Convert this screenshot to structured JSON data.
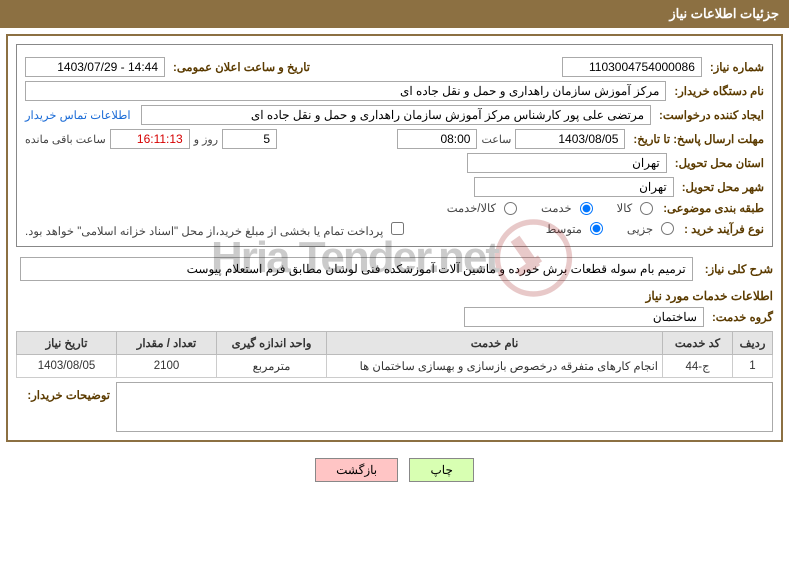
{
  "header": {
    "title": "جزئیات اطلاعات نیاز"
  },
  "need_number": {
    "label": "شماره نیاز:",
    "value": "1103004754000086"
  },
  "announce": {
    "label": "تاریخ و ساعت اعلان عمومی:",
    "value": "14:44 - 1403/07/29"
  },
  "buyer_org": {
    "label": "نام دستگاه خریدار:",
    "value": "مرکز آموزش سازمان راهداری و حمل و نقل جاده ای"
  },
  "requester": {
    "label": "ایجاد کننده درخواست:",
    "value": "مرتضی علی پور کارشناس مرکز آموزش سازمان راهداری و حمل و نقل جاده ای"
  },
  "buyer_contact_link": "اطلاعات تماس خریدار",
  "deadline": {
    "label": "مهلت ارسال پاسخ: تا تاریخ:",
    "date": "1403/08/05",
    "time_label": "ساعت",
    "time": "08:00"
  },
  "remaining": {
    "days": "5",
    "mid": "روز و",
    "time": "16:11:13",
    "suffix": "ساعت باقی مانده"
  },
  "delivery_province": {
    "label": "استان محل تحویل:",
    "value": "تهران"
  },
  "delivery_city": {
    "label": "شهر محل تحویل:",
    "value": "تهران"
  },
  "subject_class": {
    "label": "طبقه بندی موضوعی:",
    "options": [
      "کالا",
      "خدمت",
      "کالا/خدمت"
    ],
    "selected": 1
  },
  "buy_process": {
    "label": "نوع فرآیند خرید :",
    "options": [
      "جزیی",
      "متوسط"
    ],
    "selected": 1
  },
  "treasury_note": "پرداخت تمام یا بخشی از مبلغ خرید،از محل \"اسناد خزانه اسلامی\" خواهد بود.",
  "need_desc": {
    "label": "شرح کلی نیاز:",
    "value": "ترمیم بام سوله قطعات برش خورده و ماشین آلات آموزشکده فنی لوشان مطابق فرم استعلام پیوست"
  },
  "services_info_title": "اطلاعات خدمات مورد نیاز",
  "service_group": {
    "label": "گروه خدمت:",
    "value": "ساختمان"
  },
  "table": {
    "headers": [
      "ردیف",
      "کد خدمت",
      "نام خدمت",
      "واحد اندازه گیری",
      "تعداد / مقدار",
      "تاریخ نیاز"
    ],
    "rows": [
      {
        "idx": "1",
        "code": "ج-44",
        "name": "انجام کارهای متفرقه درخصوص بازسازی و بهسازی ساختمان ها",
        "unit": "مترمربع",
        "qty": "2100",
        "date": "1403/08/05"
      }
    ]
  },
  "buyer_notes_label": "توضیحات خریدار:",
  "buttons": {
    "print": "چاپ",
    "back": "بازگشت"
  },
  "watermark_text": "Hria Tender.net"
}
